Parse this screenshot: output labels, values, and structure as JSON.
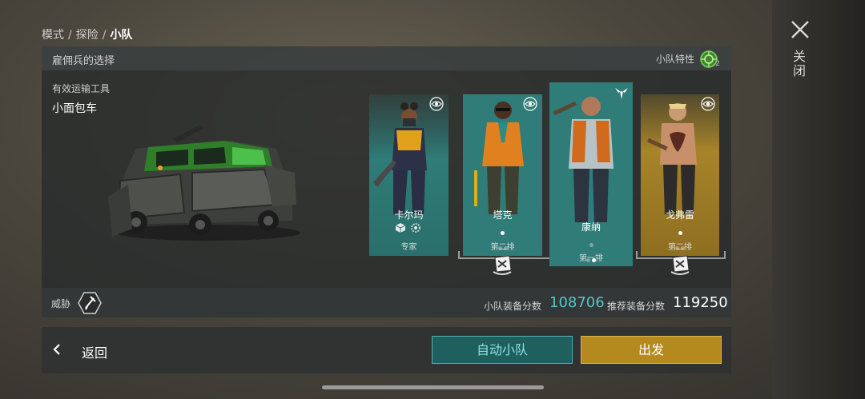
{
  "breadcrumb": {
    "item1": "模式",
    "item2": "探险",
    "item3": "小队",
    "separator": "/"
  },
  "close": {
    "label": "关闭",
    "icon": "close-x-icon"
  },
  "panel": {
    "title": "雇佣兵的选择",
    "traits_label": "小队特性",
    "traits_count": "2",
    "transport_label": "有效运输工具",
    "vehicle_name": "小面包车"
  },
  "mercenaries": [
    {
      "name": "卡尔玛",
      "sub": "专家",
      "theme": "teal",
      "role_icon": "eye-icon",
      "extra_icons": [
        "cube-icon",
        "gear-icon"
      ]
    },
    {
      "name": "塔克",
      "sub": "第二排",
      "theme": "teal",
      "role_icon": "eye-icon",
      "position_dots": [
        true,
        false,
        false
      ]
    },
    {
      "name": "康纳",
      "sub": "第一排",
      "theme": "teal",
      "role_icon": "winged-shield-icon",
      "position_dots": [
        false,
        false,
        true
      ]
    },
    {
      "name": "戈弗雷",
      "sub": "第二排",
      "theme": "gold",
      "role_icon": "eye-icon",
      "position_dots": [
        true,
        false,
        false
      ]
    }
  ],
  "footer": {
    "threat_label": "威胁",
    "squad_score_label": "小队装备分数",
    "squad_score": "108706",
    "recommended_label": "推荐装备分数",
    "recommended_score": "119250"
  },
  "actions": {
    "back": "返回",
    "auto_squad": "自动小队",
    "depart": "出发"
  },
  "colors": {
    "teal_card": "#2f7c78",
    "gold_card": "#a7842a",
    "accent_teal": "#56c6c8",
    "depart_gold": "#b48a1f"
  }
}
